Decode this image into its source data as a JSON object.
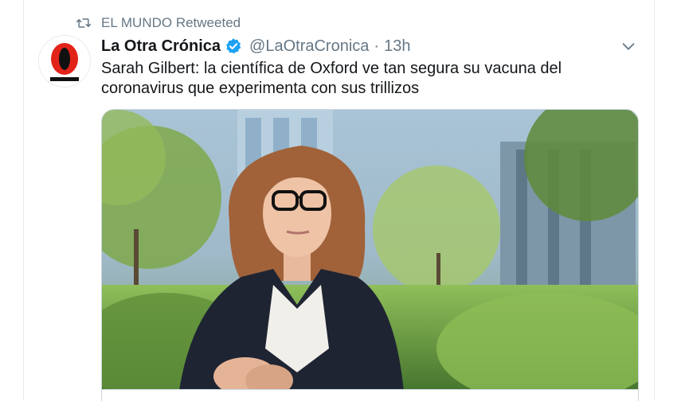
{
  "retweet": {
    "icon": "retweet-icon",
    "label": "EL MUNDO Retweeted"
  },
  "author": {
    "avatar_icon": "la-otra-cronica-logo",
    "name": "La Otra Crónica",
    "verified_icon": "verified-badge-icon",
    "handle": "@LaOtraCronica",
    "separator": "·",
    "time": "13h"
  },
  "tweet": {
    "text": "Sarah Gilbert: la científica de Oxford ve tan segura su vacuna del coronavirus que experimenta con sus trillizos"
  },
  "media": {
    "type": "photo",
    "subject": "woman-portrait-photo"
  },
  "menu_icon": "chevron-down-icon",
  "colors": {
    "text": "#14171a",
    "secondary": "#657786",
    "verified": "#1da1f2",
    "logo_red": "#e2231a"
  }
}
